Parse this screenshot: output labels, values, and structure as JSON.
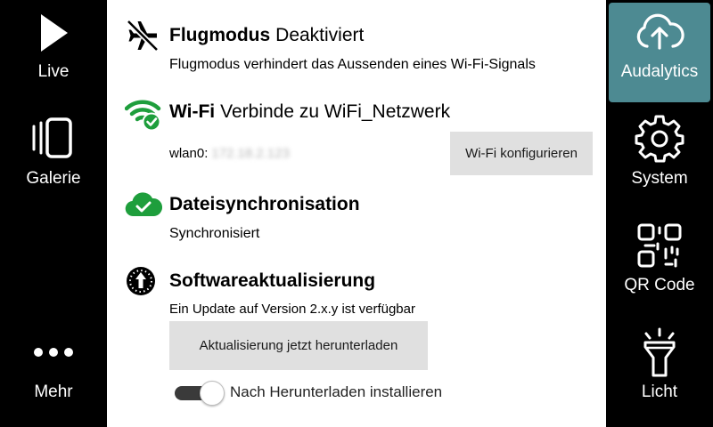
{
  "colors": {
    "accent": "#4d8a92",
    "success_green": "#1e9e3c",
    "button_gray": "#e0e0e0"
  },
  "left_nav": {
    "items": [
      {
        "label": "Live",
        "icon": "play-icon"
      },
      {
        "label": "Galerie",
        "icon": "gallery-icon"
      },
      {
        "label": "Mehr",
        "icon": "more-dots-icon"
      }
    ]
  },
  "right_nav": {
    "items": [
      {
        "label": "Audalytics",
        "icon": "cloud-upload-icon",
        "active": true
      },
      {
        "label": "System",
        "icon": "gear-icon"
      },
      {
        "label": "QR Code",
        "icon": "qr-code-icon"
      },
      {
        "label": "Licht",
        "icon": "flashlight-icon"
      }
    ]
  },
  "main": {
    "airplane": {
      "title": "Flugmodus",
      "status": "Deaktiviert",
      "description": "Flugmodus verhindert das Aussenden eines Wi-Fi-Signals",
      "icon": "airplane-off-icon"
    },
    "wifi": {
      "title": "Wi-Fi",
      "status": "Verbinde zu WiFi_Netzwerk",
      "interface_label": "wlan0:",
      "ip_masked": "172.18.2.123",
      "configure_button": "Wi-Fi konfigurieren",
      "icon": "wifi-connected-icon"
    },
    "sync": {
      "title": "Dateisynchronisation",
      "status": "Synchronisiert",
      "icon": "cloud-check-icon"
    },
    "update": {
      "title": "Softwareaktualisierung",
      "description": "Ein Update auf Version 2.x.y ist verfügbar",
      "download_button": "Aktualisierung jetzt herunterladen",
      "auto_install_label": "Nach Herunterladen installieren",
      "auto_install_enabled": true,
      "icon": "update-arrow-icon"
    }
  }
}
